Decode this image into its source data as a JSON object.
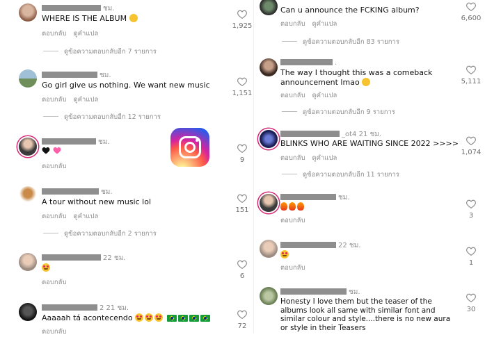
{
  "labels": {
    "reply": "ตอบกลับ",
    "translate": "ดูคำแปล"
  },
  "colors": {
    "ring": "#d62976",
    "meta": "#8e8e8e"
  },
  "left": [
    {
      "time": "ชม.",
      "text": "WHERE IS THE ALBUM",
      "emoji": [
        "crying-face"
      ],
      "likes": "1,925",
      "replies": "ดูข้อความตอบกลับอีก 7 รายการ",
      "translate": true
    },
    {
      "time": "ชม.",
      "text": "Go girl give us nothing. We want new music",
      "likes": "1,151",
      "replies": "ดูข้อความตอบกลับอีก 12 รายการ",
      "translate": true
    },
    {
      "time": "ชม.",
      "text": "",
      "emoji": [
        "black-heart",
        "sparkling-heart"
      ],
      "likes": "9",
      "replies": "",
      "translate": false
    },
    {
      "time": "ชม.",
      "text": "A tour without new music lol",
      "likes": "151",
      "replies": "ดูข้อความตอบกลับอีก 2 รายการ",
      "translate": true
    },
    {
      "time": "22 ชม.",
      "text": "",
      "emoji": [
        "heart-eyes"
      ],
      "likes": "6",
      "replies": "",
      "translate": false
    },
    {
      "time": "2 21 ชม.",
      "text": "Aaaaah tá acontecendo",
      "emoji": [
        "heart-eyes",
        "heart-eyes",
        "heart-eyes",
        "brazil-flag",
        "brazil-flag",
        "brazil-flag",
        "brazil-flag"
      ],
      "likes": "72",
      "replies": "",
      "translate": false
    }
  ],
  "right": [
    {
      "text": "Can u announce the FCKING album?",
      "likes": "6,600",
      "replies": "ดูข้อความตอบกลับอีก 83 รายการ",
      "translate": true
    },
    {
      "time": ".",
      "text": "The way I thought this was a comeback announcement lmao",
      "emoji": [
        "crying-face"
      ],
      "likes": "5,111",
      "replies": "ดูข้อความตอบกลับอีก 9 รายการ",
      "translate": true
    },
    {
      "user_suffix": "_ot4",
      "time": "21 ชม.",
      "text": "BLINKS WHO ARE WAITING SINCE 2022 >>>>",
      "likes": "1,074",
      "replies": "ดูข้อความตอบกลับอีก 11 รายการ",
      "translate": true
    },
    {
      "time": "ชม.",
      "text": "",
      "emoji": [
        "fire",
        "fire",
        "fire"
      ],
      "likes": "3",
      "replies": "",
      "translate": false
    },
    {
      "time": "22 ชม.",
      "text": "",
      "emoji": [
        "heart-eyes"
      ],
      "likes": "1",
      "replies": "",
      "translate": false
    },
    {
      "time": "ชม.",
      "text": "Honesty I love them but the teaser of the albums look all same with similar font and similar colour and style....there is no new aura or style in their Teasers",
      "likes": "30",
      "replies": "",
      "translate": false
    }
  ],
  "overlay": {
    "icon": "instagram-logo-icon"
  }
}
